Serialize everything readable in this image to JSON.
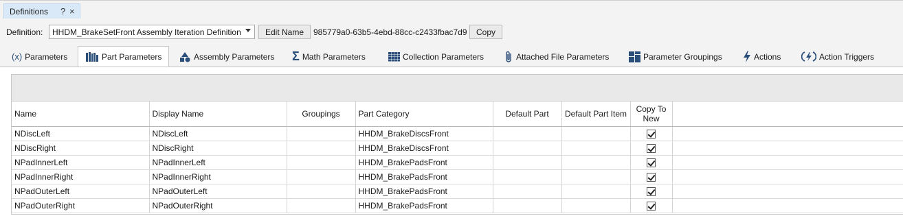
{
  "doc_tab": {
    "label": "Definitions",
    "pin_glyph": "?",
    "close_glyph": "×"
  },
  "definition_bar": {
    "label": "Definition:",
    "selected": "HHDM_BrakeSetFront Assembly Iteration Definition",
    "edit_label": "Edit Name",
    "id": "985779a0-63b5-4ebd-88cc-c2433fbac7d9",
    "copy_label": "Copy"
  },
  "tabs": [
    {
      "label": "Parameters",
      "icon": "x-variable-icon",
      "glyph": "(x)"
    },
    {
      "label": "Part Parameters",
      "icon": "part-parameters-icon",
      "glyph": ""
    },
    {
      "label": "Assembly Parameters",
      "icon": "shapes-icon",
      "glyph": ""
    },
    {
      "label": "Math Parameters",
      "icon": "sigma-icon",
      "glyph": "Σ"
    },
    {
      "label": "Collection Parameters",
      "icon": "grid-icon",
      "glyph": ""
    },
    {
      "label": "Attached File Parameters",
      "icon": "paperclip-icon",
      "glyph": ""
    },
    {
      "label": "Parameter Groupings",
      "icon": "groupings-icon",
      "glyph": ""
    },
    {
      "label": "Actions",
      "icon": "lightning-icon",
      "glyph": ""
    },
    {
      "label": "Action Triggers",
      "icon": "action-trigger-icon",
      "glyph": ""
    }
  ],
  "active_tab": "Part Parameters",
  "grid": {
    "columns": [
      "Name",
      "Display Name",
      "Groupings",
      "Part Category",
      "Default Part",
      "Default Part Item",
      "Copy To\nNew"
    ],
    "rows": [
      {
        "name": "NDiscLeft",
        "display": "NDiscLeft",
        "groupings": "",
        "category": "HHDM_BrakeDiscsFront",
        "default_part": "",
        "default_part_item": "",
        "copy_to_new": true
      },
      {
        "name": "NDiscRight",
        "display": "NDiscRight",
        "groupings": "",
        "category": "HHDM_BrakeDiscsFront",
        "default_part": "",
        "default_part_item": "",
        "copy_to_new": true
      },
      {
        "name": "NPadInnerLeft",
        "display": "NPadInnerLeft",
        "groupings": "",
        "category": "HHDM_BrakePadsFront",
        "default_part": "",
        "default_part_item": "",
        "copy_to_new": true
      },
      {
        "name": "NPadInnerRight",
        "display": "NPadInnerRight",
        "groupings": "",
        "category": "HHDM_BrakePadsFront",
        "default_part": "",
        "default_part_item": "",
        "copy_to_new": true
      },
      {
        "name": "NPadOuterLeft",
        "display": "NPadOuterLeft",
        "groupings": "",
        "category": "HHDM_BrakePadsFront",
        "default_part": "",
        "default_part_item": "",
        "copy_to_new": true
      },
      {
        "name": "NPadOuterRight",
        "display": "NPadOuterRight",
        "groupings": "",
        "category": "HHDM_BrakePadsFront",
        "default_part": "",
        "default_part_item": "",
        "copy_to_new": true
      }
    ]
  },
  "colors": {
    "accent": "#2b4d7a",
    "tab_highlight": "#d9e9f8"
  }
}
